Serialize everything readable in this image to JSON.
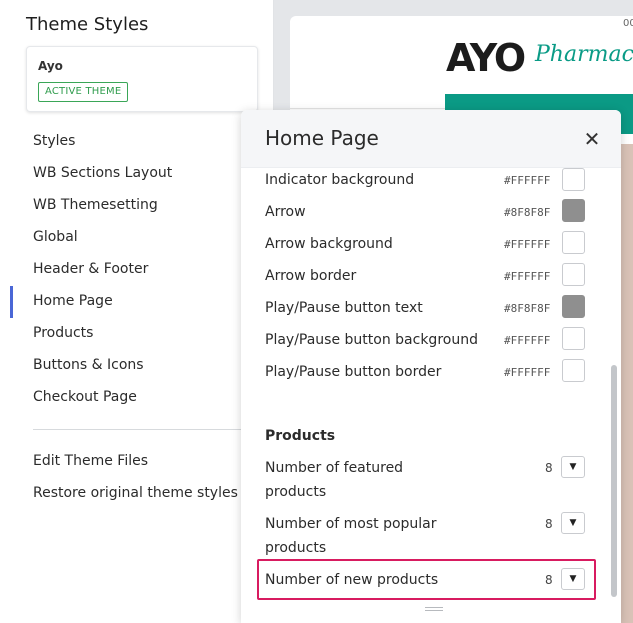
{
  "sidebar": {
    "title": "Theme Styles",
    "theme_card": {
      "name": "Ayo",
      "badge": "ACTIVE THEME"
    },
    "nav_items": [
      {
        "label": "Styles"
      },
      {
        "label": "WB Sections Layout"
      },
      {
        "label": "WB Themesetting"
      },
      {
        "label": "Global"
      },
      {
        "label": "Header & Footer"
      },
      {
        "label": "Home Page",
        "active": true
      },
      {
        "label": "Products"
      },
      {
        "label": "Buttons & Icons"
      },
      {
        "label": "Checkout Page"
      }
    ],
    "footer_items": [
      {
        "label": "Edit Theme Files"
      },
      {
        "label": "Restore original theme styles"
      }
    ]
  },
  "preview": {
    "logo_text": "AYO",
    "logo_sub": "Pharmac",
    "corner_text": "00"
  },
  "panel": {
    "title": "Home Page",
    "close_icon": "close-icon",
    "color_rows": [
      {
        "label": "Indicator background",
        "hex": "#FFFFFF",
        "color": "#FFFFFF"
      },
      {
        "label": "Arrow",
        "hex": "#8F8F8F",
        "color": "#8F8F8F"
      },
      {
        "label": "Arrow background",
        "hex": "#FFFFFF",
        "color": "#FFFFFF"
      },
      {
        "label": "Arrow border",
        "hex": "#FFFFFF",
        "color": "#FFFFFF"
      },
      {
        "label": "Play/Pause button text",
        "hex": "#8F8F8F",
        "color": "#8F8F8F"
      },
      {
        "label": "Play/Pause button background",
        "hex": "#FFFFFF",
        "color": "#FFFFFF"
      },
      {
        "label": "Play/Pause button border",
        "hex": "#FFFFFF",
        "color": "#FFFFFF"
      }
    ],
    "products_heading": "Products",
    "number_rows": [
      {
        "label": "Number of featured products",
        "value": "8"
      },
      {
        "label": "Number of most popular products",
        "value": "8"
      },
      {
        "label": "Number of new products",
        "value": "8",
        "highlighted": true
      }
    ]
  },
  "colors": {
    "accent": "#4A67D6",
    "active_badge": "#2F9C4D",
    "highlight": "#D81B60",
    "brand_teal": "#0B9A85"
  }
}
